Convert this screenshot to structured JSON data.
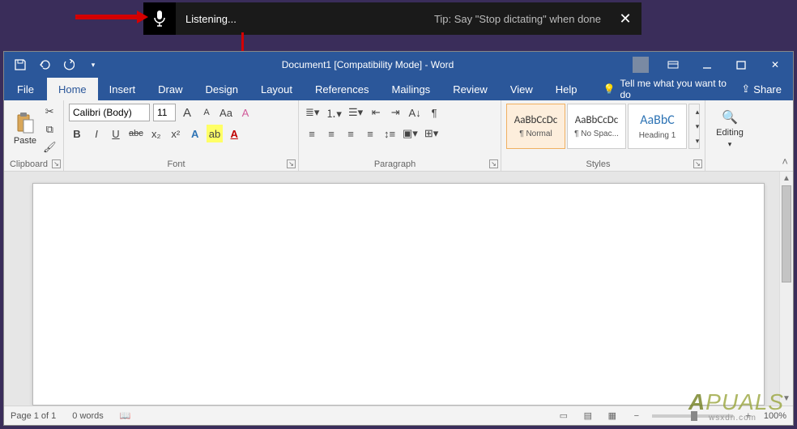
{
  "dictation": {
    "status": "Listening...",
    "tip": "Tip: Say \"Stop dictating\" when done"
  },
  "title": "Document1 [Compatibility Mode] - Word",
  "tabs": {
    "file": "File",
    "home": "Home",
    "insert": "Insert",
    "draw": "Draw",
    "design": "Design",
    "layout": "Layout",
    "references": "References",
    "mailings": "Mailings",
    "review": "Review",
    "view": "View",
    "help": "Help"
  },
  "tellme": "Tell me what you want to do",
  "share": "Share",
  "ribbon": {
    "clipboard": {
      "label": "Clipboard",
      "paste": "Paste"
    },
    "font": {
      "label": "Font",
      "name": "Calibri (Body)",
      "size": "11",
      "bold": "B",
      "italic": "I",
      "underline": "U",
      "strike": "abc",
      "sub": "x₂",
      "sup": "x²",
      "effects": "A",
      "highlight": "ab",
      "color": "A",
      "grow": "A",
      "shrink": "A",
      "case": "Aa",
      "clear": "A"
    },
    "paragraph": {
      "label": "Paragraph"
    },
    "styles": {
      "label": "Styles",
      "preview": "AaBbCcDc",
      "preview3": "AaBbC",
      "items": [
        "¶ Normal",
        "¶ No Spac...",
        "Heading 1"
      ]
    },
    "editing": {
      "label": "Editing"
    }
  },
  "statusbar": {
    "page": "Page 1 of 1",
    "words": "0 words",
    "zoom": "100%"
  },
  "watermark": {
    "brand_prefix": "A",
    "brand_suffix": "PUALS",
    "site": "wsxdn.com"
  }
}
